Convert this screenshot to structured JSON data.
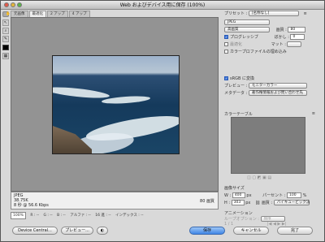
{
  "window": {
    "title": "Web およびデバイス用に保存 (100%)"
  },
  "tabs": [
    "元画像",
    "最適化",
    "2 アップ",
    "4 アップ"
  ],
  "info": {
    "format": "JPEG",
    "size": "38.75K",
    "speed": "8 秒 @ 56.6 Kbps",
    "quality": "80 画質"
  },
  "status": {
    "zoom": "100%",
    "r": "R : --",
    "g": "G : --",
    "b": "B : --",
    "alpha": "アルファ : --",
    "hex": "16 進 : --",
    "index": "インデックス : --"
  },
  "preset": {
    "label": "プリセット :",
    "value": "[名称なし]",
    "format": "JPEG",
    "quality_level": "高画質",
    "quality_label": "画質 :",
    "quality_value": "80",
    "progressive_label": "プログレッシブ",
    "blur_label": "ぼかし :",
    "blur_value": "0",
    "optimized_label": "最適化",
    "matte_label": "マット :",
    "embed_profile_label": "カラープロファイルの埋め込み"
  },
  "color": {
    "srgb_label": "sRGB に変換",
    "preview_label": "プレビュー :",
    "preview_value": "モニターカラー",
    "metadata_label": "メタデータ :",
    "metadata_value": "著作権情報および問い合わせ先",
    "color_table_label": "カラーテーブル"
  },
  "image_size": {
    "label": "画像サイズ",
    "w_label": "W :",
    "w_value": "400",
    "h_label": "H :",
    "h_value": "303",
    "unit": "px",
    "percent_label": "パーセント :",
    "percent_value": "100",
    "percent_unit": "%",
    "quality_label": "画質 :",
    "quality_value": "バイキュービック法"
  },
  "animation": {
    "label": "アニメーション",
    "loop_label": "ループオプション :",
    "loop_value": "無限",
    "frame": "1 / 1"
  },
  "buttons": {
    "device_central": "Device Central...",
    "preview": "プレビュー...",
    "save": "保存",
    "cancel": "キャンセル",
    "done": "完了"
  },
  "colors": {
    "accent": "#3f86e6",
    "panel": "#d9d9d9",
    "preview_bg": "#939393"
  }
}
